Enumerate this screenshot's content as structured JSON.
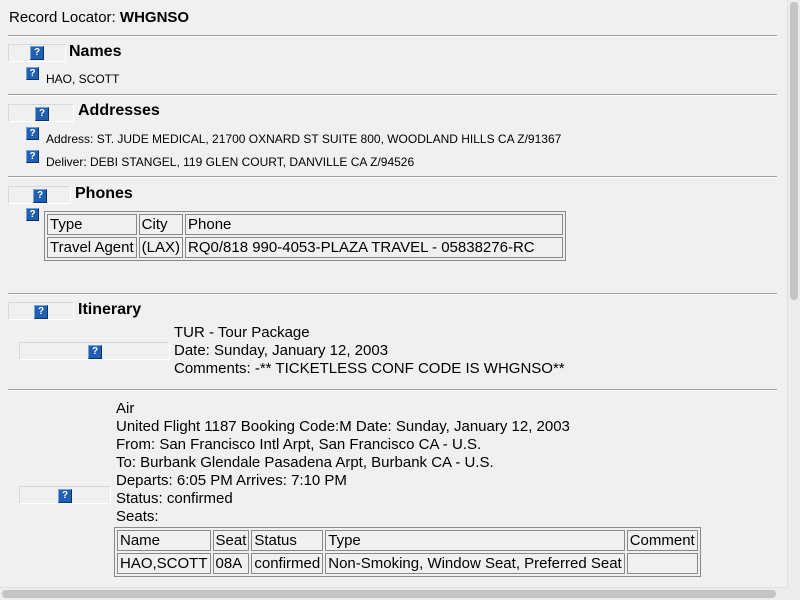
{
  "record": {
    "label": "Record Locator:",
    "value": "WHGNSO"
  },
  "help_icon": "?",
  "names": {
    "title": "Names",
    "items": [
      "HAO, SCOTT"
    ]
  },
  "addresses": {
    "title": "Addresses",
    "items": [
      "Address: ST. JUDE MEDICAL, 21700 OXNARD ST SUITE 800, WOODLAND HILLS CA Z/91367",
      "Deliver: DEBI STANGEL, 119 GLEN COURT, DANVILLE CA Z/94526"
    ]
  },
  "phones": {
    "title": "Phones",
    "headers": [
      "Type",
      "City",
      "Phone"
    ],
    "rows": [
      [
        "Travel Agent",
        "(LAX)",
        "RQ0/818 990-4053-PLAZA TRAVEL - 05838276-RC"
      ]
    ]
  },
  "itinerary": {
    "title": "Itinerary",
    "tour": {
      "type": "TUR - Tour Package",
      "date": "Date: Sunday, January 12, 2003",
      "comments": "Comments: -** TICKETLESS CONF CODE IS WHGNSO**"
    },
    "air": {
      "type": "Air",
      "flight": "United Flight 1187 Booking Code:M Date: Sunday, January 12, 2003",
      "from": "From: San Francisco Intl Arpt, San Francisco CA - U.S.",
      "to": "To: Burbank Glendale Pasadena Arpt, Burbank CA - U.S.",
      "departs": "Departs: 6:05 PM Arrives: 7:10 PM",
      "status": "Status: confirmed",
      "seats_label": "Seats:",
      "seat_headers": [
        "Name",
        "Seat",
        "Status",
        "Type",
        "Comment"
      ],
      "seat_rows": [
        [
          "HAO,SCOTT",
          "08A",
          "confirmed",
          "Non-Smoking, Window Seat, Preferred Seat",
          ""
        ]
      ]
    }
  },
  "colors": {
    "help_icon_bg": "#1f5fb4",
    "page_bg": "#f0f0f0",
    "rule": "#a0a0a0"
  }
}
